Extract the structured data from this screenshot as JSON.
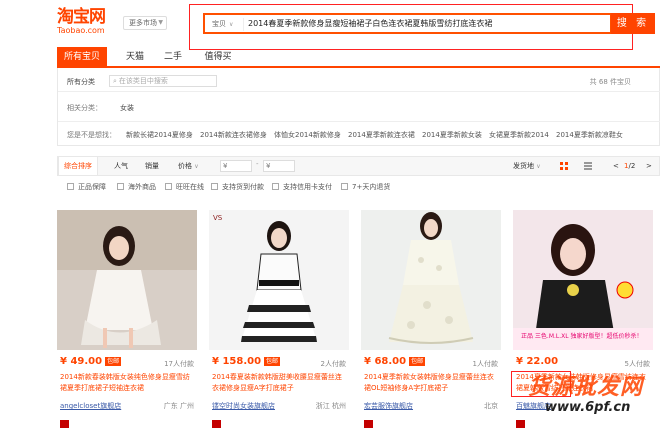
{
  "header": {
    "logo_cn": "淘宝网",
    "logo_en": "Taobao.com",
    "market_label": "更多市场",
    "search_type": "宝贝",
    "search_query": "2014春夏季新款修身显瘦短袖裙子白色连衣裙夏韩版雪纺打底连衣裙",
    "search_button": "搜 索"
  },
  "tabs": [
    "所有宝贝",
    "天猫",
    "二手",
    "值得买"
  ],
  "filter": {
    "all_categories": "所有分类",
    "category_search_placeholder": "在该类目中搜索",
    "count_text": "共 68 件宝贝",
    "related_label": "相关分类：",
    "related_value": "女装",
    "guess_label": "您是不是想找：",
    "guesses": [
      "新款长裙2014夏修身",
      "2014新款连衣裙修身",
      "体恤女2014新款修身",
      "2014夏季新款连衣裙",
      "2014夏季新款女装",
      "女裙夏季新款2014",
      "2014夏季新款凉鞋女"
    ]
  },
  "sortbar": {
    "items": [
      "综合排序",
      "人气",
      "销量",
      "价格"
    ],
    "price_from": "¥",
    "price_to": "¥",
    "ship_from": "发货地",
    "page_current": "1",
    "page_total": "/2"
  },
  "options": [
    "正品保障",
    "海外商品",
    "旺旺在线",
    "支持货到付款",
    "支持信用卡支付",
    "7+天内退货"
  ],
  "products": [
    {
      "price": "¥ 49.00",
      "badge": "包邮",
      "sold": "17人付款",
      "title": "2014新款春装韩版女装纯色修身显瘦雪纺裙夏季打底裙子短袖连衣裙",
      "shop": "angelcloset旗舰店",
      "location": "广东 广州"
    },
    {
      "price": "¥ 158.00",
      "badge": "包邮",
      "sold": "2人付款",
      "title": "2014春夏装新款韩版甜美收腰显瘦蕾丝连衣裙修身显瘦A字打底裙子",
      "shop": "镂空时尚女装旗舰店",
      "location": "浙江 杭州"
    },
    {
      "price": "¥ 68.00",
      "badge": "包邮",
      "sold": "1人付款",
      "title": "2014夏季新款女装韩版修身显瘦蕾丝连衣裙OL短袖修身A字打底裙子",
      "shop": "宏芸服饰旗舰店",
      "location": "北京"
    },
    {
      "price": "¥ 22.00",
      "badge": "",
      "sold": "5人付款",
      "title": "2014夏季新款女装韩版修身显瘦雪纺连衣裙夏韩版雪纺打底连衣裙",
      "shop": "百魅旗舰店",
      "location": ""
    }
  ],
  "watermark": {
    "text": "货源批发网",
    "url": "www.6pf.cn"
  }
}
